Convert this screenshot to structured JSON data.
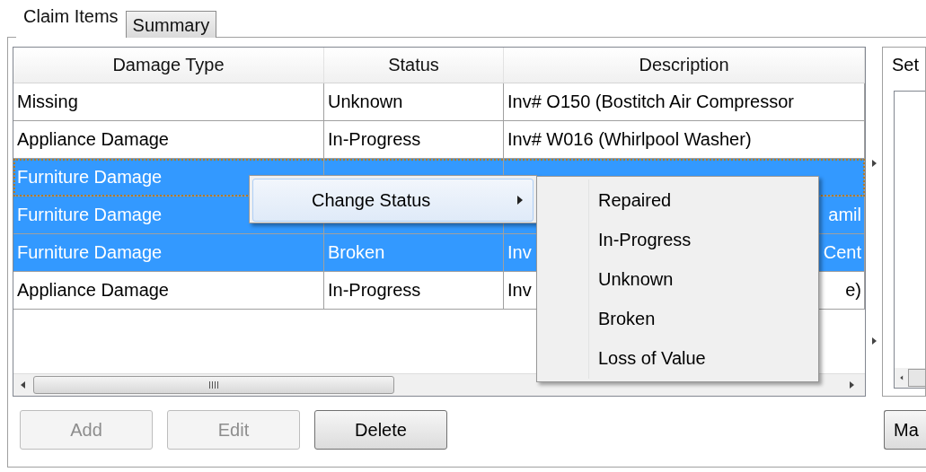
{
  "tabs": [
    {
      "label": "Claim Items",
      "selected": true
    },
    {
      "label": "Summary",
      "selected": false
    }
  ],
  "grid": {
    "columns": [
      "Damage Type",
      "Status",
      "Description"
    ],
    "rows": [
      {
        "damage_type": "Missing",
        "status": "Unknown",
        "description": "Inv# O150 (Bostitch Air Compressor",
        "selected": false,
        "focused": false
      },
      {
        "damage_type": "Appliance Damage",
        "status": "In-Progress",
        "description": "Inv# W016 (Whirlpool Washer)",
        "selected": false,
        "focused": false
      },
      {
        "damage_type": "Furniture Damage",
        "selected": true,
        "focused": true
      },
      {
        "damage_type": "Furniture Damage",
        "description_end": "amil",
        "selected": true,
        "focused": false
      },
      {
        "damage_type": "Furniture Damage",
        "status": "Broken",
        "description": "Inv",
        "description_end": "Cent",
        "selected": true,
        "focused": false
      },
      {
        "damage_type": "Appliance Damage",
        "status": "In-Progress",
        "description": "Inv",
        "description_end": "e)",
        "selected": false,
        "focused": false
      }
    ]
  },
  "buttons": [
    {
      "label": "Add",
      "disabled": true
    },
    {
      "label": "Edit",
      "disabled": true
    },
    {
      "label": "Delete",
      "disabled": false
    }
  ],
  "side_panel": {
    "title": "Set",
    "button": "Ma"
  },
  "context_menu": {
    "items": [
      {
        "label": "Change Status",
        "has_submenu": true
      }
    ]
  },
  "submenu": {
    "items": [
      "Repaired",
      "In-Progress",
      "Unknown",
      "Broken",
      "Loss of Value"
    ]
  }
}
